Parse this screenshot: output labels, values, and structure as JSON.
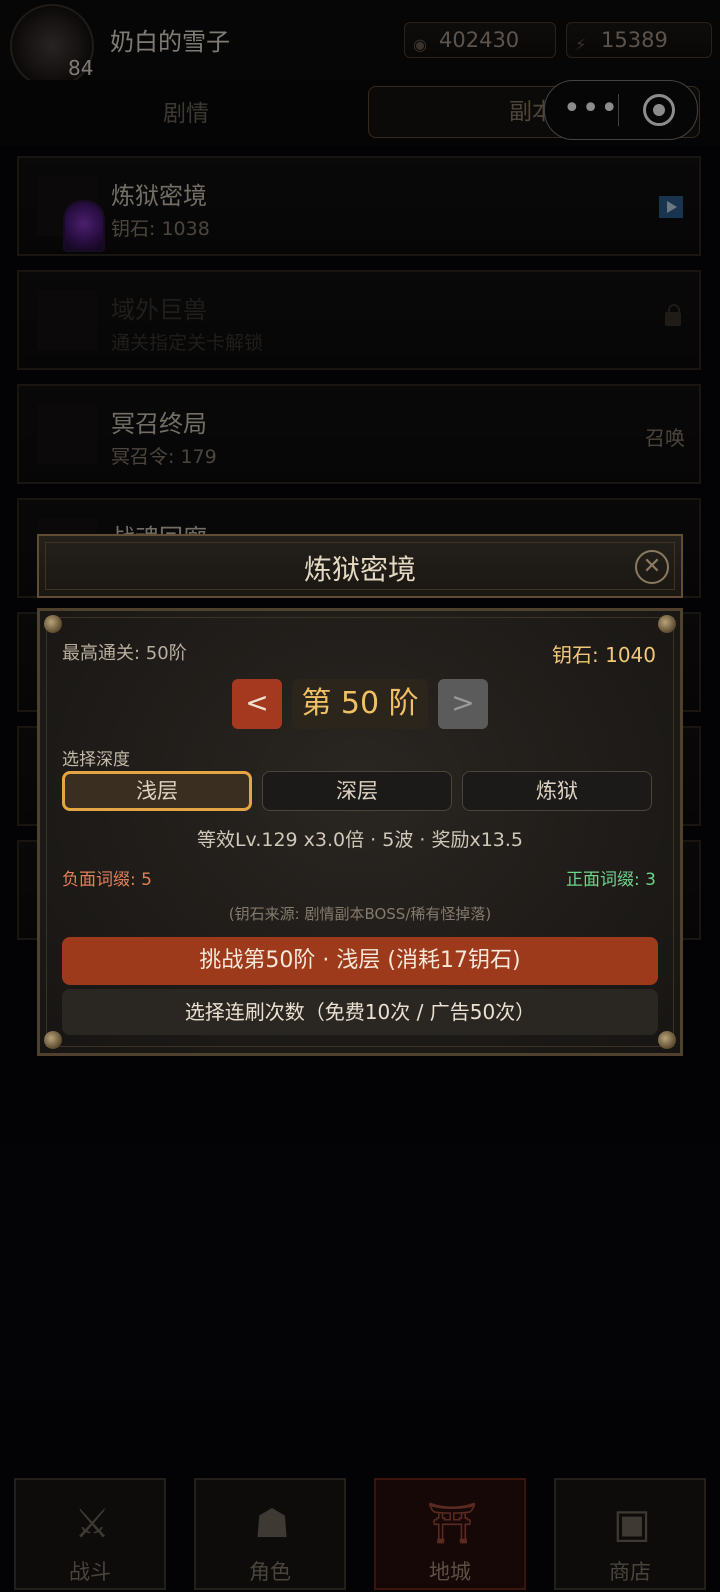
{
  "header": {
    "player_name": "奶白的雪子",
    "level": "84",
    "gold": "402430",
    "energy": "15389",
    "gold_icon": "coin-icon",
    "energy_icon": "lightning-icon"
  },
  "tabs": {
    "story": "剧情",
    "dungeon": "副本"
  },
  "capsule": {
    "more_icon": "more-dots-icon",
    "close_icon": "target-circle-icon"
  },
  "dungeons": [
    {
      "title": "炼狱密境",
      "sub": "钥石: 1038",
      "right_icon": "play-icon",
      "locked": false
    },
    {
      "title": "域外巨兽",
      "sub": "通关指定关卡解锁",
      "right_icon": "lock-icon",
      "locked": true
    },
    {
      "title": "冥召终局",
      "sub": "冥召令: 179",
      "right": "召唤",
      "locked": false
    },
    {
      "title": "战魂回廊",
      "locked": false
    }
  ],
  "modal": {
    "title": "炼狱密境",
    "best_clear": "最高通关: 50阶",
    "keystone": "钥石: 1040",
    "prev": "<",
    "stage": "第 50 阶",
    "next": ">",
    "depth_label": "选择深度",
    "depths": [
      "浅层",
      "深层",
      "炼狱"
    ],
    "selected_depth": "浅层",
    "stats": "等效Lv.129  x3.0倍  ·  5波  ·  奖励x13.5",
    "negative_affix": "负面词缀: 5",
    "positive_affix": "正面词缀: 3",
    "source_note": "(钥石来源: 剧情副本BOSS/稀有怪掉落)",
    "challenge_button": "挑战第50阶 · 浅层 (消耗17钥石)",
    "sweep_button": "选择连刷次数（免费10次 / 广告50次）"
  },
  "bottom_nav": [
    {
      "label": "战斗",
      "icon": "crossed-swords-icon"
    },
    {
      "label": "角色",
      "icon": "character-helmet-icon"
    },
    {
      "label": "地城",
      "icon": "dungeon-gate-icon",
      "active": true
    },
    {
      "label": "商店",
      "icon": "treasure-chest-icon"
    }
  ],
  "colors": {
    "accent_gold": "#f1bf64",
    "challenge_red": "#9e3a1c",
    "negative": "#e08058",
    "positive": "#6fd48b"
  }
}
